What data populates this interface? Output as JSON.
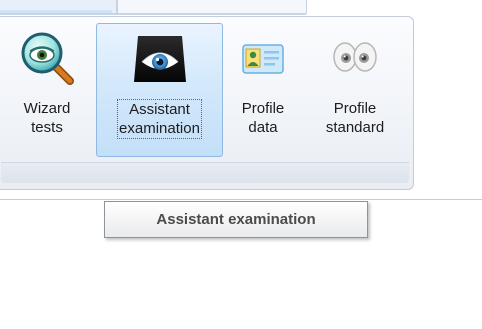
{
  "ribbon": {
    "buttons": [
      {
        "id": "wizard-tests",
        "label": "Wizard\ntests",
        "icon": "magnifier-eye-icon",
        "active": false
      },
      {
        "id": "assistant-examination",
        "label": "Assistant\nexamination",
        "icon": "eye-scanner-icon",
        "active": true
      },
      {
        "id": "profile-data",
        "label": "Profile\ndata",
        "icon": "id-card-icon",
        "active": false
      },
      {
        "id": "profile-standard",
        "label": "Profile\nstandard",
        "icon": "eyes-icon",
        "active": false
      }
    ]
  },
  "tooltip": {
    "text": "Assistant examination"
  },
  "colors": {
    "active_fill": "#c3dff8",
    "active_border": "#8fb8e3",
    "ribbon_bg": "#f1f4f9"
  }
}
